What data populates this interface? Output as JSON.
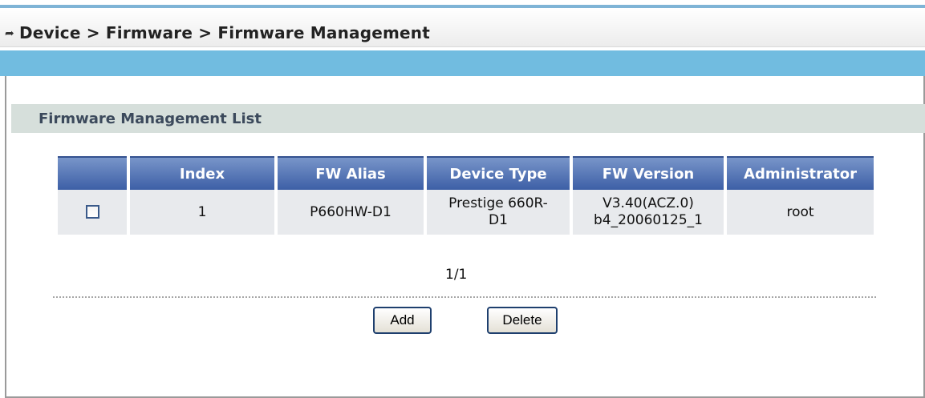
{
  "breadcrumb": {
    "icon": "double-arrow-icon",
    "text": "Device > Firmware > Firmware Management"
  },
  "section": {
    "title": "Firmware Management List"
  },
  "table": {
    "headers": {
      "select": "",
      "index": "Index",
      "alias": "FW Alias",
      "device_type": "Device Type",
      "version": "FW Version",
      "administrator": "Administrator"
    },
    "rows": [
      {
        "checked": false,
        "index": "1",
        "alias": "P660HW-D1",
        "device_type_line1": "Prestige 660R-",
        "device_type_line2": "D1",
        "version_line1": "V3.40(ACZ.0)",
        "version_line2": "b4_20060125_1",
        "administrator": "root"
      }
    ]
  },
  "pager": {
    "text": "1/1"
  },
  "buttons": {
    "add": "Add",
    "delete": "Delete"
  },
  "colors": {
    "header_band": "#71bce0",
    "table_header": "#4a6cb0",
    "section_bar": "#d6dfdb",
    "row_bg": "#e8eaed"
  }
}
